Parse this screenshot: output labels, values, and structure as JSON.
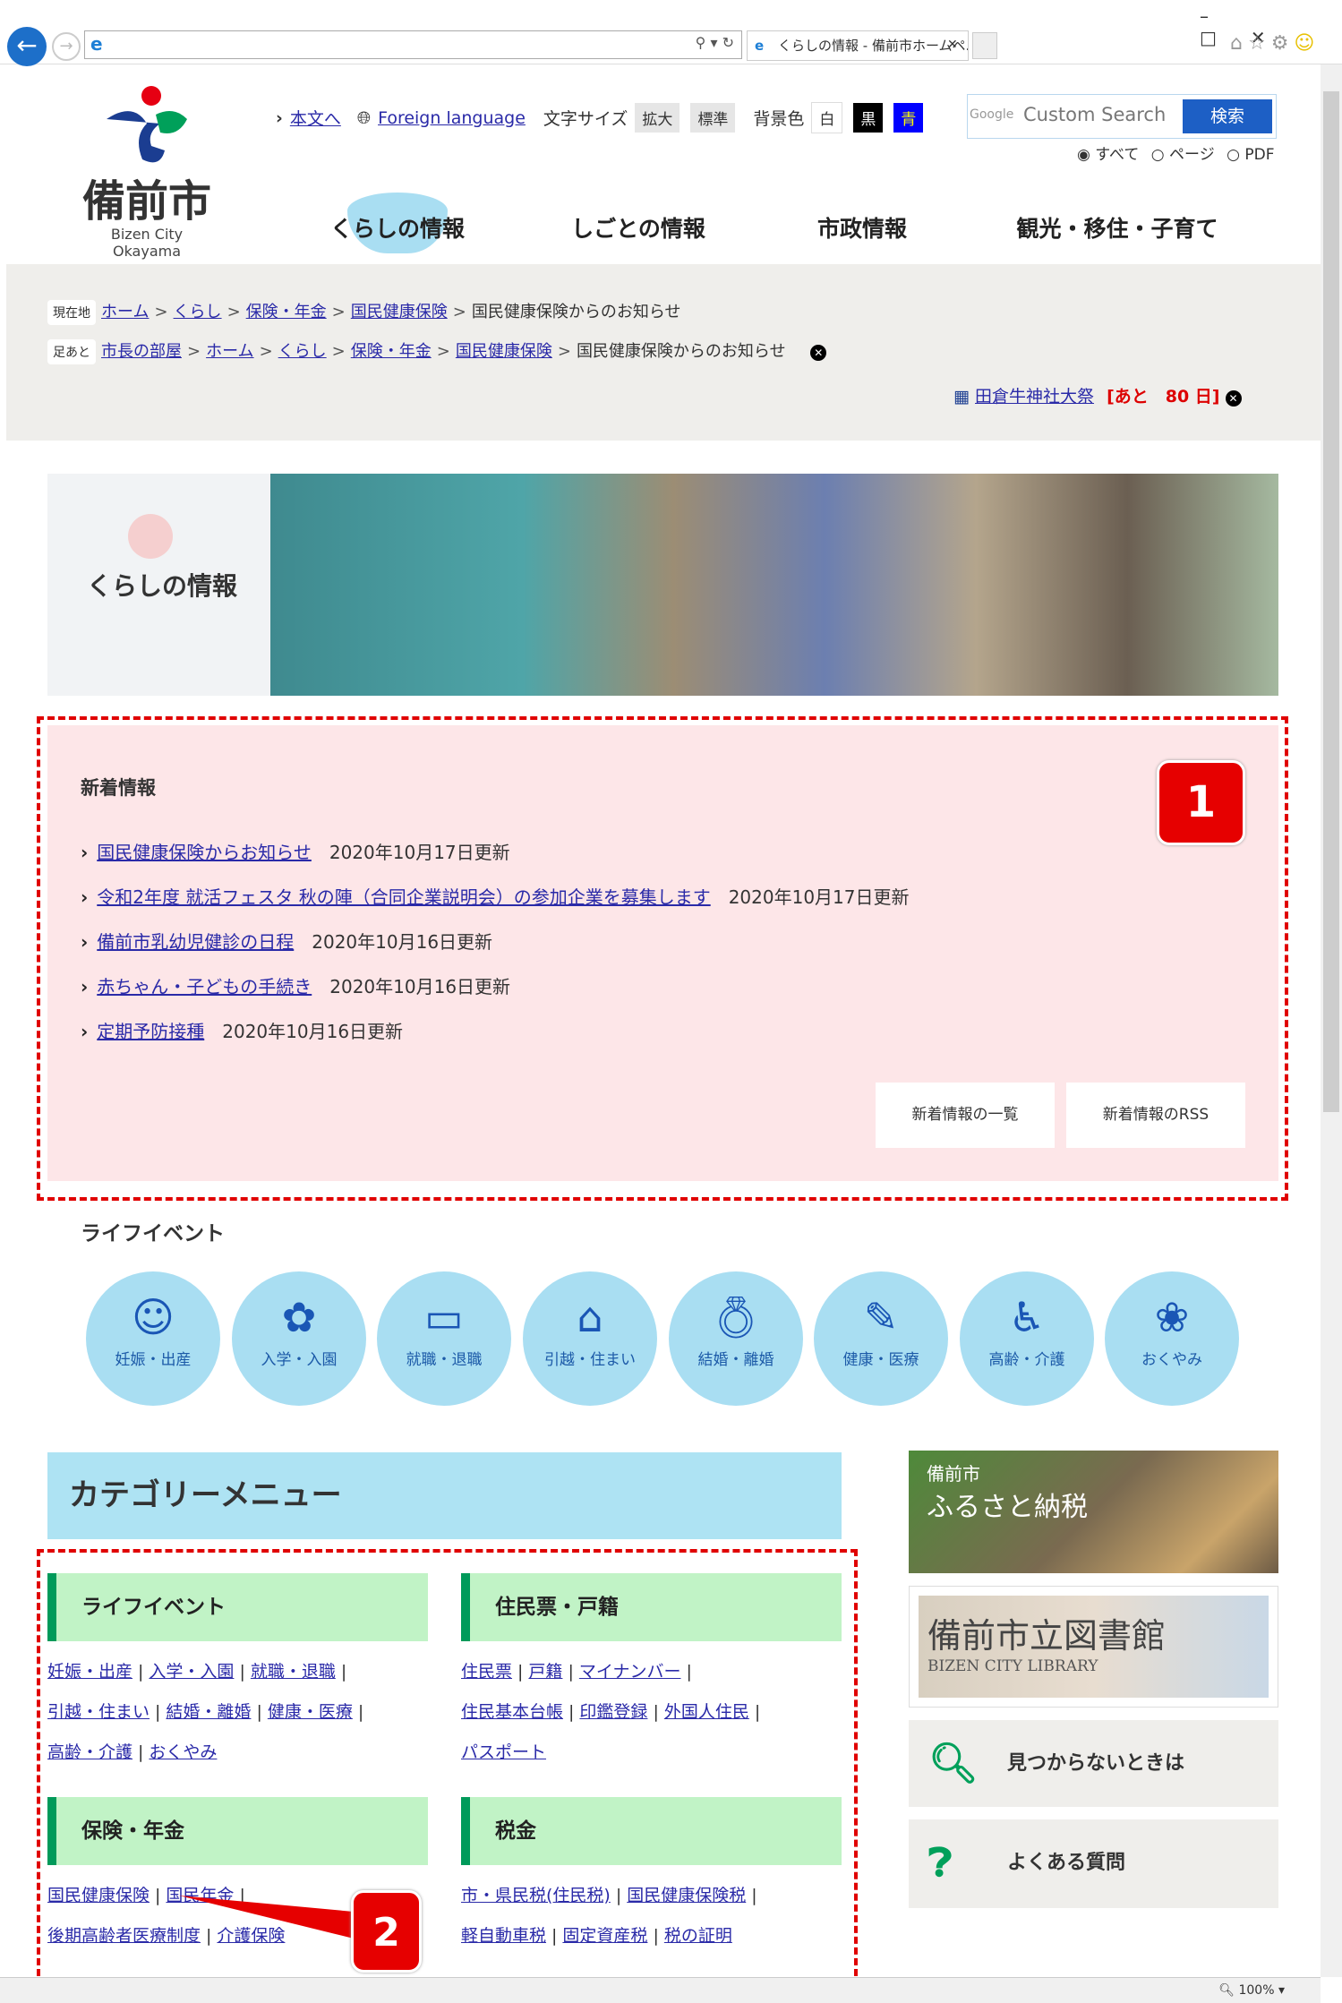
{
  "browser": {
    "tab_title": "くらしの情報 - 備前市ホームペ...",
    "zoom": "100%"
  },
  "header": {
    "logo_kanji": "備前市",
    "logo_sub": "Bizen City Okayama",
    "skip_link": "本文へ",
    "foreign": "Foreign language",
    "text_size_label": "文字サイズ",
    "enlarge": "拡大",
    "standard": "標準",
    "bg_label": "背景色",
    "bg_white": "白",
    "bg_black": "黒",
    "bg_blue": "青",
    "search_placeholder": "Custom Search",
    "google": "Google",
    "search_button": "検索",
    "radio": [
      "すべて",
      "ページ",
      "PDF"
    ]
  },
  "nav": [
    "くらしの情報",
    "しごとの情報",
    "市政情報",
    "観光・移住・子育て"
  ],
  "breadcrumb": {
    "current_tag": "現在地",
    "current": [
      "ホーム",
      "くらし",
      "保険・年金",
      "国民健康保険"
    ],
    "current_page": "国民健康保険からのお知らせ",
    "history_tag": "足あと",
    "history": [
      "市長の部屋",
      "ホーム",
      "くらし",
      "保険・年金",
      "国民健康保険"
    ],
    "history_page": "国民健康保険からのお知らせ"
  },
  "event": {
    "name": "田倉牛神社大祭",
    "countdown": "[あと　80 日]"
  },
  "banner": {
    "title": "くらしの情報"
  },
  "news": {
    "heading": "新着情報",
    "items": [
      {
        "title": "国民健康保険からお知らせ",
        "date": "2020年10月17日更新"
      },
      {
        "title": "令和2年度 就活フェスタ 秋の陣（合同企業説明会）の参加企業を募集します",
        "date": "2020年10月17日更新"
      },
      {
        "title": "備前市乳幼児健診の日程",
        "date": "2020年10月16日更新"
      },
      {
        "title": "赤ちゃん・子どもの手続き",
        "date": "2020年10月16日更新"
      },
      {
        "title": "定期予防接種",
        "date": "2020年10月16日更新"
      }
    ],
    "list_button": "新着情報の一覧",
    "rss_button": "新着情報のRSS"
  },
  "annotations": {
    "badge1": "1",
    "badge2": "2"
  },
  "life_events": {
    "heading": "ライフイベント",
    "items": [
      {
        "label": "妊娠・出産",
        "icon": "baby-icon"
      },
      {
        "label": "入学・入園",
        "icon": "sakura-icon"
      },
      {
        "label": "就職・退職",
        "icon": "briefcase-icon"
      },
      {
        "label": "引越・住まい",
        "icon": "house-icon"
      },
      {
        "label": "結婚・離婚",
        "icon": "ring-icon"
      },
      {
        "label": "健康・医療",
        "icon": "syringe-icon"
      },
      {
        "label": "高齢・介護",
        "icon": "wheelchair-icon"
      },
      {
        "label": "おくやみ",
        "icon": "lotus-icon"
      }
    ]
  },
  "category": {
    "heading": "カテゴリーメニュー",
    "groups": [
      {
        "title": "ライフイベント",
        "links": [
          "妊娠・出産",
          "入学・入園",
          "就職・退職",
          "引越・住まい",
          "結婚・離婚",
          "健康・医療",
          "高齢・介護",
          "おくやみ"
        ]
      },
      {
        "title": "住民票・戸籍",
        "links": [
          "住民票",
          "戸籍",
          "マイナンバー",
          "住民基本台帳",
          "印鑑登録",
          "外国人住民",
          "パスポート"
        ]
      },
      {
        "title": "保険・年金",
        "links": [
          "国民健康保険",
          "国民年金",
          "後期高齢者医療制度",
          "介護保険"
        ]
      },
      {
        "title": "税金",
        "links": [
          "市・県民税(住民税)",
          "国民健康保険税",
          "軽自動車税",
          "固定資産税",
          "税の証明"
        ]
      }
    ]
  },
  "side": {
    "furusato_small": "備前市",
    "furusato": "ふるさと納税",
    "library": "備前市立図書館",
    "library_en": "BIZEN CITY LIBRARY",
    "notfound": "見つからないときは",
    "faq": "よくある質問"
  },
  "colors": {
    "accent_blue": "#1d5fc5",
    "annotation_red": "#e60000",
    "news_bg": "#fde6e8",
    "category_bg": "#aee3f3",
    "group_bg": "#c1f3c6"
  }
}
